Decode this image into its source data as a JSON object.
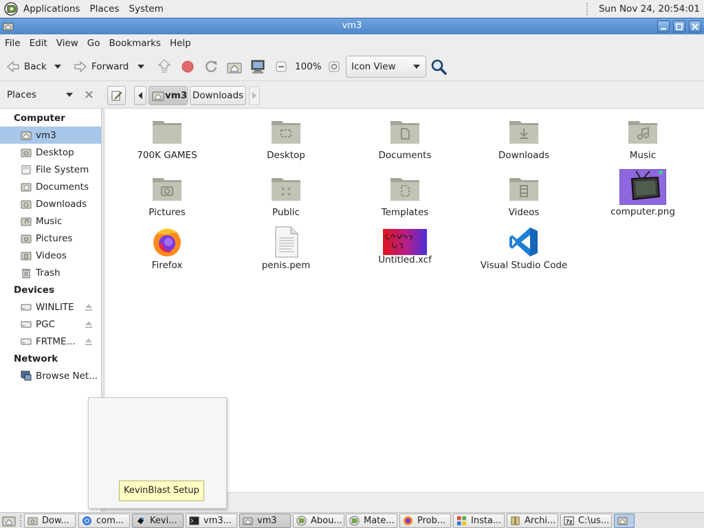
{
  "top_panel": {
    "menus": [
      "Applications",
      "Places",
      "System"
    ],
    "clock": "Sun Nov 24, 20:54:01"
  },
  "window": {
    "title": "vm3",
    "menubar": [
      "File",
      "Edit",
      "View",
      "Go",
      "Bookmarks",
      "Help"
    ]
  },
  "toolbar": {
    "back_label": "Back",
    "forward_label": "Forward",
    "zoom_level": "100%",
    "view_mode": "Icon View"
  },
  "location": {
    "places_label": "Places",
    "breadcrumbs": [
      "vm3",
      "Downloads"
    ]
  },
  "sidebar": {
    "sections": [
      {
        "heading": "Computer",
        "items": [
          "vm3",
          "Desktop",
          "File System",
          "Documents",
          "Downloads",
          "Music",
          "Pictures",
          "Videos",
          "Trash"
        ]
      },
      {
        "heading": "Devices",
        "items": [
          "WINLITE",
          "PGC",
          "FRTME..."
        ]
      },
      {
        "heading": "Network",
        "items": [
          "Browse Net..."
        ]
      }
    ],
    "selected": "vm3"
  },
  "files": [
    {
      "name": "700K GAMES",
      "icon": "folder-icon"
    },
    {
      "name": "Desktop",
      "icon": "folder-desktop-icon"
    },
    {
      "name": "Documents",
      "icon": "folder-documents-icon"
    },
    {
      "name": "Downloads",
      "icon": "folder-downloads-icon"
    },
    {
      "name": "Music",
      "icon": "folder-music-icon"
    },
    {
      "name": "Pictures",
      "icon": "folder-pictures-icon"
    },
    {
      "name": "Public",
      "icon": "folder-public-icon"
    },
    {
      "name": "Templates",
      "icon": "folder-templates-icon"
    },
    {
      "name": "Videos",
      "icon": "folder-videos-icon"
    },
    {
      "name": "computer.png",
      "icon": "image-thumbnail-icon"
    },
    {
      "name": "Firefox",
      "icon": "firefox-icon"
    },
    {
      "name": "penis.pem",
      "icon": "text-file-icon"
    },
    {
      "name": "Untitled.xcf",
      "icon": "xcf-thumbnail-icon"
    },
    {
      "name": "Visual Studio Code",
      "icon": "vscode-icon"
    }
  ],
  "tooltip": "KevinBlast Setup",
  "taskbar": {
    "tasks": [
      "Dow...",
      "com...",
      "Kevi...",
      "vm3...",
      "vm3",
      "Abou...",
      "Mate...",
      "Prob...",
      "Insta...",
      "Archi...",
      "C:\\us..."
    ]
  },
  "colors": {
    "titlebar": "#5b93d4",
    "selection": "#a8c7ea",
    "folder": "#b9b9ab",
    "tooltip": "#ffffc4"
  }
}
